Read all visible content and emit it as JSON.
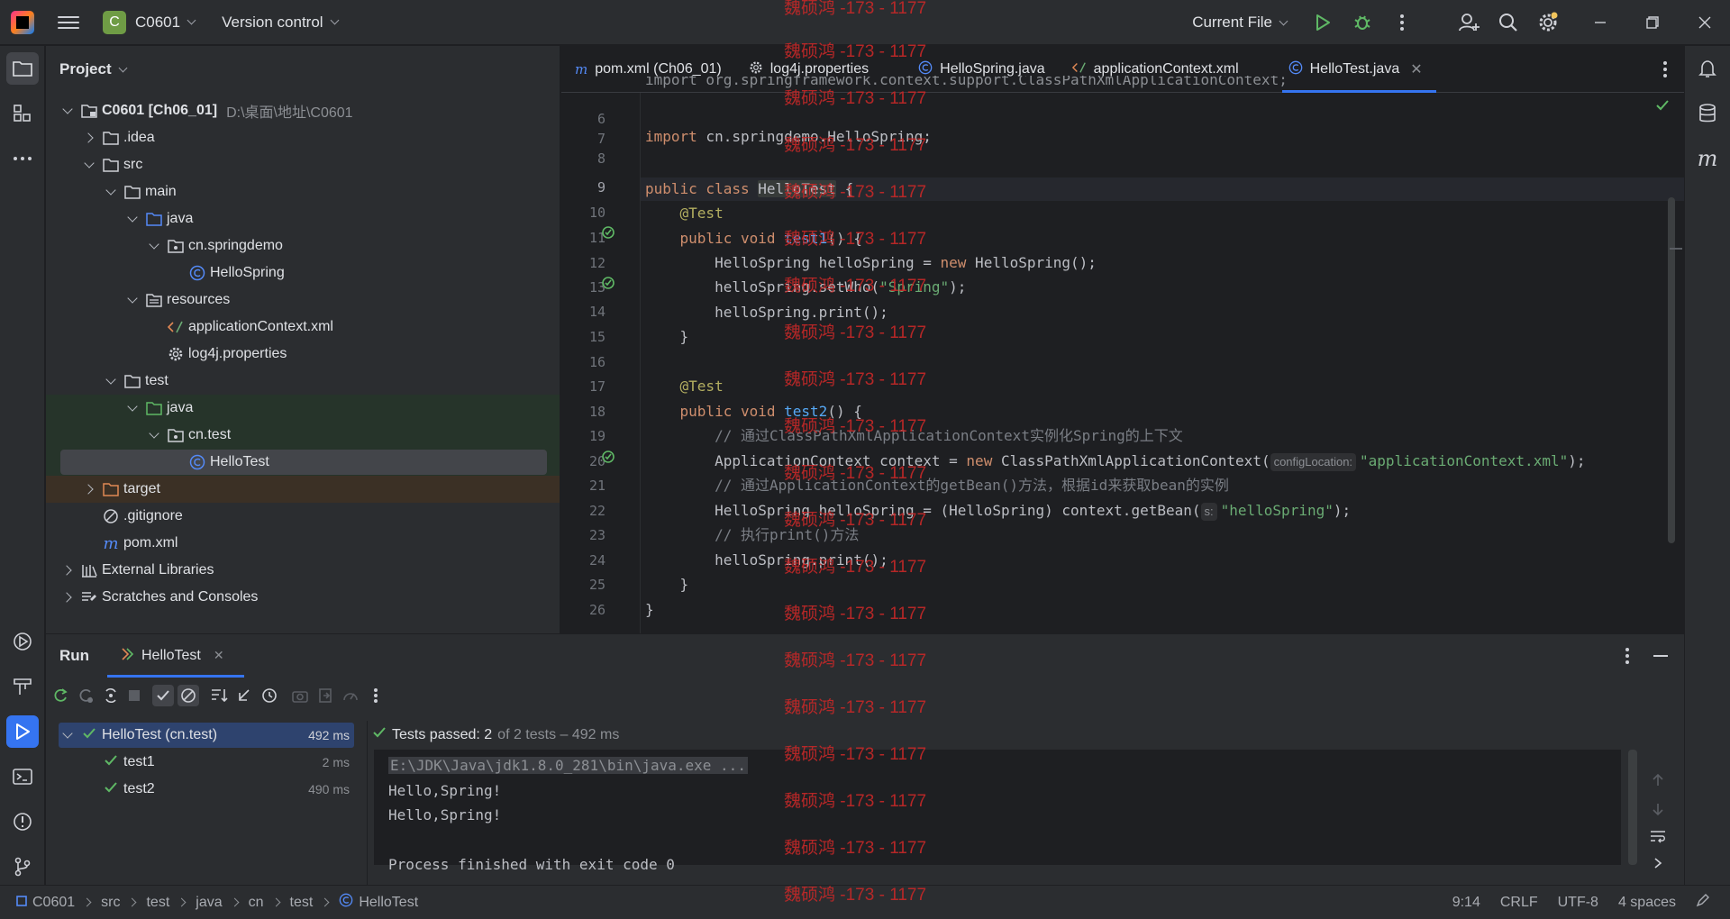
{
  "titlebar": {
    "project_badge": "C",
    "project_name": "C0601",
    "vcs": "Version control",
    "run_config": "Current File"
  },
  "project_panel": {
    "title": "Project",
    "root_name": "C0601 [Ch06_01]",
    "root_path": "D:\\桌面\\地址\\C0601",
    "items": {
      "idea": ".idea",
      "src": "src",
      "main": "main",
      "java_main": "java",
      "pkg_springdemo": "cn.springdemo",
      "hellospring": "HelloSpring",
      "resources": "resources",
      "appctx": "applicationContext.xml",
      "log4j": "log4j.properties",
      "test": "test",
      "java_test": "java",
      "pkg_test": "cn.test",
      "hellotest": "HelloTest",
      "target": "target",
      "gitignore": ".gitignore",
      "pom": "pom.xml",
      "ext_libs": "External Libraries",
      "scratches": "Scratches and Consoles"
    }
  },
  "editor": {
    "tabs": [
      {
        "label": "pom.xml (Ch06_01)",
        "icon": "maven-icon"
      },
      {
        "label": "log4j.properties",
        "icon": "gear-icon"
      },
      {
        "label": "HelloSpring.java",
        "icon": "class-icon"
      },
      {
        "label": "applicationContext.xml",
        "icon": "xml-icon"
      },
      {
        "label": "HelloTest.java",
        "icon": "class-icon"
      }
    ],
    "line_numbers": [
      "6",
      "7",
      "8",
      "9",
      "10",
      "11",
      "12",
      "13",
      "14",
      "15",
      "16",
      "17",
      "18",
      "19",
      "20",
      "21",
      "22",
      "23",
      "24",
      "25",
      "26"
    ],
    "code": {
      "l5": "import org.springframework.context.support.ClassPathXmlApplicationContext;",
      "l7_kw": "import",
      "l7_rest": " cn.springdemo.HelloSpring;",
      "l9_kw": "public class",
      "l9_name": "HelloTest",
      "l9_rest": " {",
      "l10": "@Test",
      "l11_kw": "public void",
      "l11_name": "test1",
      "l11_rest": "() {",
      "l12_a": "HelloSpring helloSpring = ",
      "l12_kw": "new",
      "l12_b": " HelloSpring();",
      "l13_a": "helloSpring.setWho(",
      "l13_str": "\"Spring\"",
      "l13_b": ");",
      "l14": "helloSpring.print();",
      "l15": "}",
      "l17": "@Test",
      "l18_kw": "public void",
      "l18_name": "test2",
      "l18_rest": "() {",
      "l19": "// 通过ClassPathXmlApplicationContext实例化Spring的上下文",
      "l20_a": "ApplicationContext context = ",
      "l20_kw": "new",
      "l20_b": " ClassPathXmlApplicationContext(",
      "l20_hint": "configLocation:",
      "l20_str": "\"applicationContext.xml\"",
      "l20_c": ");",
      "l21": "// 通过ApplicationContext的getBean()方法，根据id来获取bean的实例",
      "l22_a": "HelloSpring helloSpring = (HelloSpring) context.getBean(",
      "l22_hint": "s:",
      "l22_str": "\"helloSpring\"",
      "l22_b": ");",
      "l23": "// 执行print()方法",
      "l24": "helloSpring.print();",
      "l25": "}",
      "l26": "}"
    }
  },
  "run_panel": {
    "title": "Run",
    "tab": "HelloTest",
    "tests": [
      {
        "name": "HelloTest (cn.test)",
        "duration": "492 ms"
      },
      {
        "name": "test1",
        "duration": "2 ms"
      },
      {
        "name": "test2",
        "duration": "490 ms"
      }
    ],
    "summary_bold": "Tests passed: 2",
    "summary_rest": "of 2 tests – 492 ms",
    "console": [
      "E:\\JDK\\Java\\jdk1.8.0_281\\bin\\java.exe ...",
      "Hello,Spring!",
      "Hello,Spring!",
      "",
      "Process finished with exit code 0"
    ]
  },
  "statusbar": {
    "breadcrumbs": [
      "C0601",
      "src",
      "test",
      "java",
      "cn",
      "test",
      "HelloTest"
    ],
    "position": "9:14",
    "line_sep": "CRLF",
    "encoding": "UTF-8",
    "indent": "4 spaces"
  },
  "watermark": "魏硕鸿 -173 - 1177",
  "colors": {
    "accent": "#3574f0",
    "pass_green": "#5fb865",
    "keyword": "#cf8e6d",
    "string": "#6aab73",
    "annotation": "#b3ae60",
    "method": "#56a8f5",
    "watermark": "#c62828"
  }
}
